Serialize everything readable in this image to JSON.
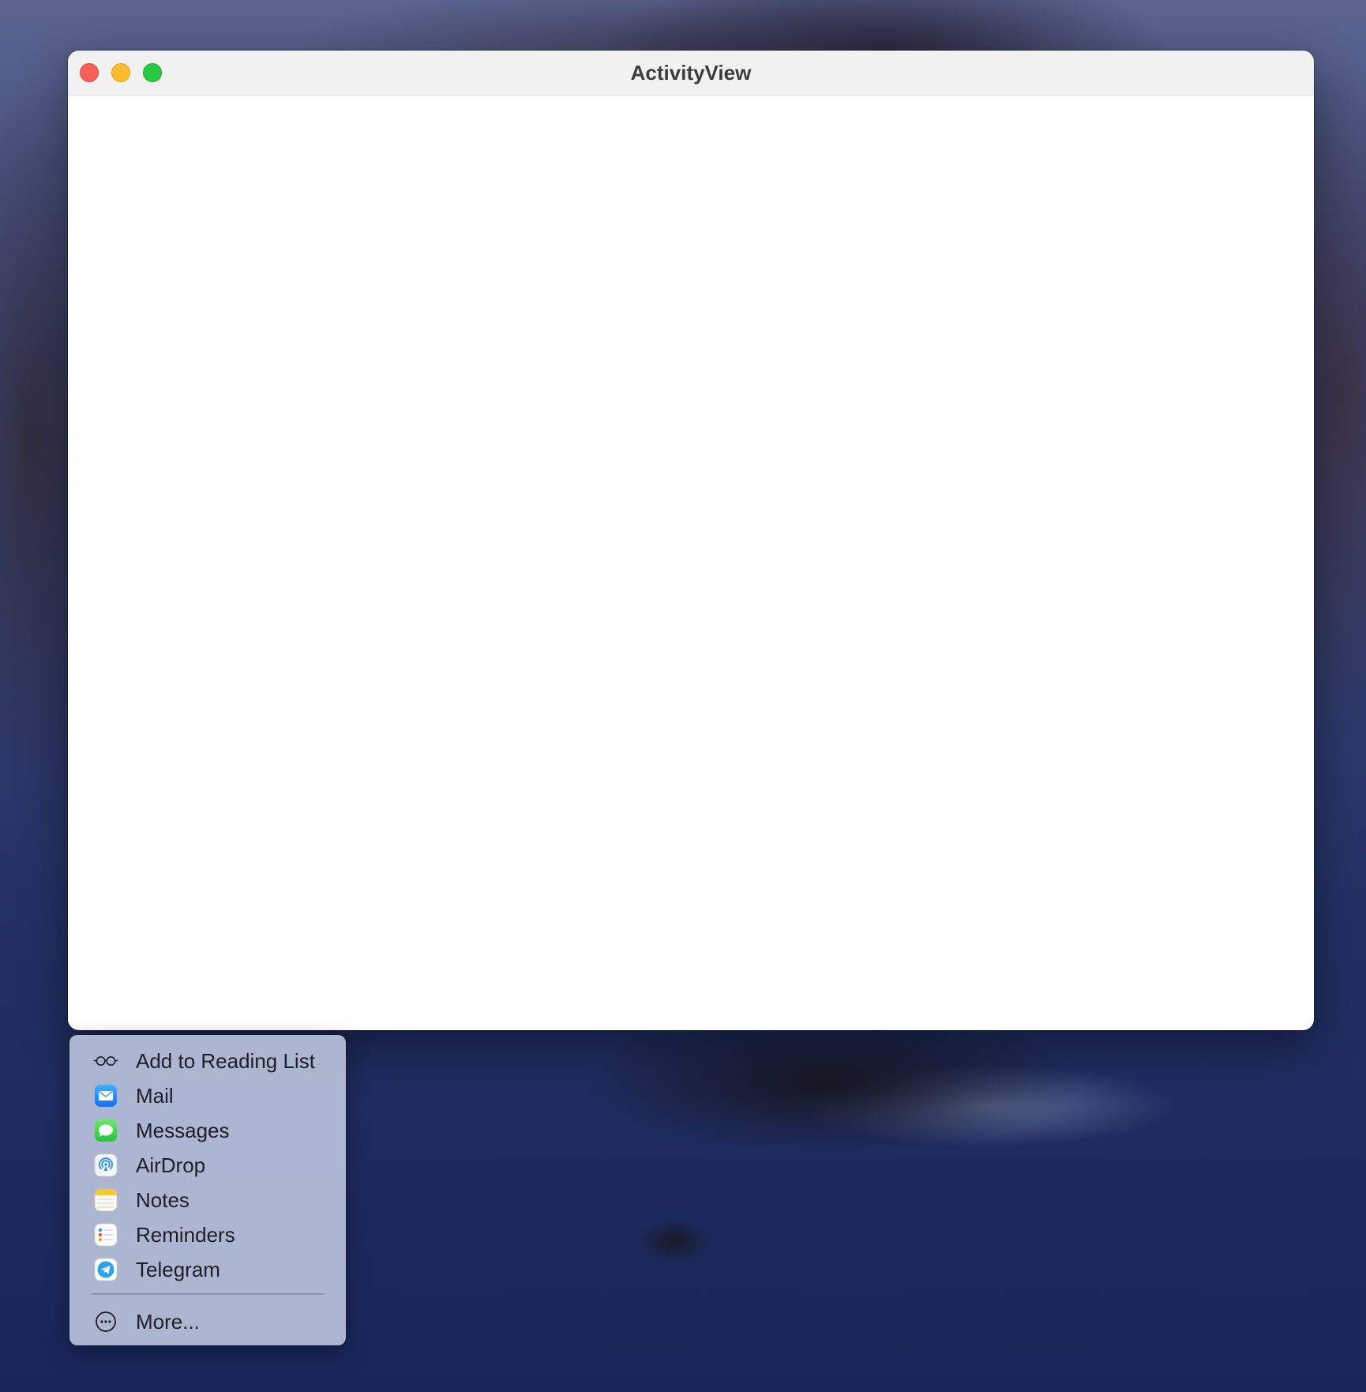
{
  "window": {
    "title": "ActivityView"
  },
  "share_menu": {
    "items": [
      {
        "label": "Add to Reading List",
        "icon": "reading-glasses-icon"
      },
      {
        "label": "Mail",
        "icon": "mail-icon"
      },
      {
        "label": "Messages",
        "icon": "messages-icon"
      },
      {
        "label": "AirDrop",
        "icon": "airdrop-icon"
      },
      {
        "label": "Notes",
        "icon": "notes-icon"
      },
      {
        "label": "Reminders",
        "icon": "reminders-icon"
      },
      {
        "label": "Telegram",
        "icon": "telegram-icon"
      }
    ],
    "more_label": "More..."
  },
  "colors": {
    "close": "#fe5f57",
    "minimize": "#febc2e",
    "zoom": "#28c840"
  }
}
